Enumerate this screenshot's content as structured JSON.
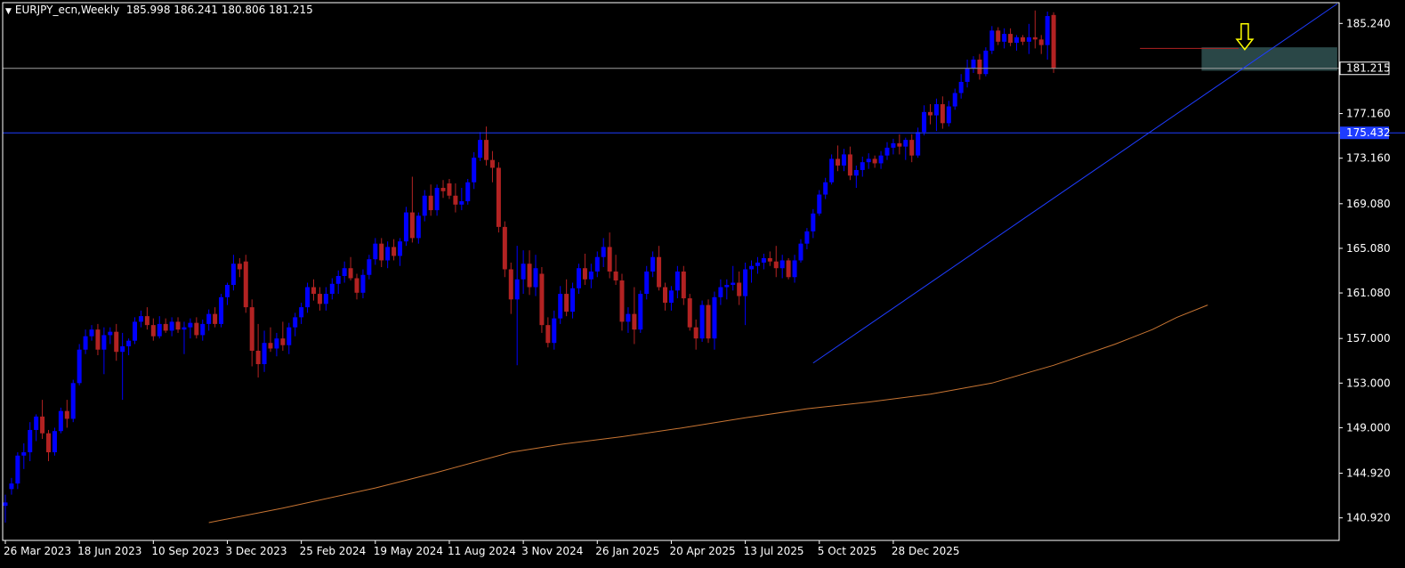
{
  "header": {
    "symbol": "EURJPY_ecn,Weekly",
    "ohlc": "185.998 186.241 180.806 181.215"
  },
  "colors": {
    "background": "#000000",
    "bull": "#0000ff",
    "bear": "#b22222",
    "axis": "#ffffff",
    "trendline": "#1e3cff",
    "ma": "#c87533",
    "level_line": "#1e3cff",
    "price_line": "#a0a0a0",
    "zone": "#2f4f4f",
    "arrow": "#ffff00"
  },
  "chart_data": {
    "type": "candlestick",
    "title": "EURJPY_ecn,Weekly",
    "timeframe": "Weekly",
    "ylim": [
      138.9,
      187.1
    ],
    "y_ticks": [
      "185.240",
      "181.215",
      "177.160",
      "175.432",
      "173.160",
      "169.080",
      "165.080",
      "161.080",
      "157.000",
      "153.000",
      "149.000",
      "144.920",
      "140.920"
    ],
    "x_ticks": [
      "26 Mar 2023",
      "18 Jun 2023",
      "10 Sep 2023",
      "3 Dec 2023",
      "25 Feb 2024",
      "19 May 2024",
      "11 Aug 2024",
      "3 Nov 2024",
      "26 Jan 2025",
      "20 Apr 2025",
      "13 Jul 2025",
      "5 Oct 2025",
      "28 Dec 2025"
    ],
    "current_price": 181.215,
    "horizontal_level": 175.432,
    "last_bar": {
      "open": 185.998,
      "high": 186.241,
      "low": 180.806,
      "close": 181.215
    },
    "candles": [
      {
        "o": 142.0,
        "h": 143.0,
        "l": 140.5,
        "c": 142.3
      },
      {
        "o": 143.5,
        "h": 144.5,
        "l": 143.0,
        "c": 144.0
      },
      {
        "o": 144.0,
        "h": 146.8,
        "l": 143.5,
        "c": 146.5
      },
      {
        "o": 146.5,
        "h": 147.6,
        "l": 145.3,
        "c": 146.8
      },
      {
        "o": 146.8,
        "h": 149.5,
        "l": 146.0,
        "c": 148.8
      },
      {
        "o": 148.8,
        "h": 150.2,
        "l": 147.8,
        "c": 150.0
      },
      {
        "o": 150.0,
        "h": 151.5,
        "l": 148.0,
        "c": 148.5
      },
      {
        "o": 148.5,
        "h": 148.8,
        "l": 146.0,
        "c": 146.8
      },
      {
        "o": 146.8,
        "h": 149.0,
        "l": 146.5,
        "c": 148.7
      },
      {
        "o": 148.7,
        "h": 150.8,
        "l": 148.5,
        "c": 150.5
      },
      {
        "o": 150.5,
        "h": 151.5,
        "l": 149.0,
        "c": 149.8
      },
      {
        "o": 149.8,
        "h": 153.3,
        "l": 149.5,
        "c": 153.0
      },
      {
        "o": 153.0,
        "h": 156.5,
        "l": 152.8,
        "c": 156.0
      },
      {
        "o": 156.0,
        "h": 157.8,
        "l": 155.6,
        "c": 157.2
      },
      {
        "o": 157.2,
        "h": 158.2,
        "l": 156.8,
        "c": 157.8
      },
      {
        "o": 157.8,
        "h": 158.3,
        "l": 155.5,
        "c": 156.0
      },
      {
        "o": 156.0,
        "h": 158.0,
        "l": 153.8,
        "c": 157.3
      },
      {
        "o": 157.3,
        "h": 158.0,
        "l": 156.5,
        "c": 157.6
      },
      {
        "o": 157.6,
        "h": 158.3,
        "l": 155.0,
        "c": 155.8
      },
      {
        "o": 155.8,
        "h": 157.5,
        "l": 151.5,
        "c": 156.3
      },
      {
        "o": 156.3,
        "h": 157.0,
        "l": 155.5,
        "c": 156.8
      },
      {
        "o": 156.8,
        "h": 158.9,
        "l": 156.5,
        "c": 158.5
      },
      {
        "o": 158.5,
        "h": 159.5,
        "l": 158.0,
        "c": 159.0
      },
      {
        "o": 159.0,
        "h": 159.8,
        "l": 157.8,
        "c": 158.2
      },
      {
        "o": 158.2,
        "h": 158.8,
        "l": 156.8,
        "c": 157.2
      },
      {
        "o": 157.2,
        "h": 159.0,
        "l": 157.0,
        "c": 158.3
      },
      {
        "o": 158.3,
        "h": 158.8,
        "l": 157.5,
        "c": 157.7
      },
      {
        "o": 157.7,
        "h": 158.9,
        "l": 157.2,
        "c": 158.5
      },
      {
        "o": 158.5,
        "h": 158.9,
        "l": 157.5,
        "c": 157.8
      },
      {
        "o": 157.8,
        "h": 158.5,
        "l": 155.6,
        "c": 158.0
      },
      {
        "o": 158.0,
        "h": 158.8,
        "l": 157.0,
        "c": 158.4
      },
      {
        "o": 158.4,
        "h": 158.9,
        "l": 157.0,
        "c": 157.3
      },
      {
        "o": 157.3,
        "h": 158.7,
        "l": 156.8,
        "c": 158.3
      },
      {
        "o": 158.3,
        "h": 159.6,
        "l": 157.7,
        "c": 159.2
      },
      {
        "o": 159.2,
        "h": 159.8,
        "l": 158.0,
        "c": 158.3
      },
      {
        "o": 158.3,
        "h": 161.0,
        "l": 158.0,
        "c": 160.7
      },
      {
        "o": 160.7,
        "h": 162.0,
        "l": 160.0,
        "c": 161.8
      },
      {
        "o": 161.8,
        "h": 164.5,
        "l": 161.3,
        "c": 163.7
      },
      {
        "o": 163.7,
        "h": 164.2,
        "l": 162.5,
        "c": 163.2
      },
      {
        "o": 163.9,
        "h": 164.5,
        "l": 159.3,
        "c": 159.8
      },
      {
        "o": 159.8,
        "h": 160.5,
        "l": 154.5,
        "c": 155.9
      },
      {
        "o": 155.9,
        "h": 158.3,
        "l": 153.5,
        "c": 154.7
      },
      {
        "o": 154.7,
        "h": 157.7,
        "l": 154.0,
        "c": 156.6
      },
      {
        "o": 156.6,
        "h": 158.0,
        "l": 155.8,
        "c": 156.1
      },
      {
        "o": 156.1,
        "h": 157.5,
        "l": 155.4,
        "c": 157.0
      },
      {
        "o": 157.0,
        "h": 158.5,
        "l": 155.9,
        "c": 156.4
      },
      {
        "o": 156.4,
        "h": 158.4,
        "l": 155.6,
        "c": 158.0
      },
      {
        "o": 158.0,
        "h": 159.3,
        "l": 157.2,
        "c": 158.9
      },
      {
        "o": 158.9,
        "h": 160.2,
        "l": 158.3,
        "c": 159.8
      },
      {
        "o": 159.8,
        "h": 162.0,
        "l": 159.3,
        "c": 161.6
      },
      {
        "o": 161.6,
        "h": 162.3,
        "l": 160.4,
        "c": 161.0
      },
      {
        "o": 161.0,
        "h": 161.6,
        "l": 159.5,
        "c": 160.1
      },
      {
        "o": 160.1,
        "h": 161.6,
        "l": 159.5,
        "c": 161.0
      },
      {
        "o": 161.0,
        "h": 162.4,
        "l": 160.5,
        "c": 161.9
      },
      {
        "o": 161.9,
        "h": 163.1,
        "l": 161.0,
        "c": 162.6
      },
      {
        "o": 162.6,
        "h": 163.9,
        "l": 162.0,
        "c": 163.3
      },
      {
        "o": 163.3,
        "h": 164.3,
        "l": 162.2,
        "c": 162.4
      },
      {
        "o": 162.4,
        "h": 162.8,
        "l": 160.5,
        "c": 161.1
      },
      {
        "o": 161.1,
        "h": 163.2,
        "l": 160.6,
        "c": 162.7
      },
      {
        "o": 162.7,
        "h": 164.5,
        "l": 162.3,
        "c": 164.1
      },
      {
        "o": 164.1,
        "h": 166.0,
        "l": 163.6,
        "c": 165.5
      },
      {
        "o": 165.5,
        "h": 166.0,
        "l": 163.4,
        "c": 164.0
      },
      {
        "o": 164.0,
        "h": 165.7,
        "l": 163.3,
        "c": 165.2
      },
      {
        "o": 165.2,
        "h": 165.9,
        "l": 164.0,
        "c": 164.4
      },
      {
        "o": 164.4,
        "h": 166.0,
        "l": 163.5,
        "c": 165.7
      },
      {
        "o": 165.7,
        "h": 168.8,
        "l": 165.3,
        "c": 168.3
      },
      {
        "o": 168.3,
        "h": 171.5,
        "l": 165.6,
        "c": 166.0
      },
      {
        "o": 166.0,
        "h": 168.3,
        "l": 165.5,
        "c": 168.0
      },
      {
        "o": 168.0,
        "h": 170.3,
        "l": 167.5,
        "c": 169.8
      },
      {
        "o": 169.8,
        "h": 170.8,
        "l": 168.0,
        "c": 168.5
      },
      {
        "o": 168.5,
        "h": 170.8,
        "l": 168.0,
        "c": 170.5
      },
      {
        "o": 170.5,
        "h": 171.2,
        "l": 169.6,
        "c": 170.2
      },
      {
        "o": 170.9,
        "h": 171.3,
        "l": 169.5,
        "c": 169.8
      },
      {
        "o": 169.8,
        "h": 170.9,
        "l": 168.3,
        "c": 169.0
      },
      {
        "o": 169.0,
        "h": 170.5,
        "l": 168.5,
        "c": 169.3
      },
      {
        "o": 169.3,
        "h": 171.3,
        "l": 169.0,
        "c": 171.0
      },
      {
        "o": 171.0,
        "h": 173.7,
        "l": 170.4,
        "c": 173.2
      },
      {
        "o": 173.2,
        "h": 175.5,
        "l": 172.9,
        "c": 174.8
      },
      {
        "o": 174.8,
        "h": 176.0,
        "l": 172.5,
        "c": 173.0
      },
      {
        "o": 173.0,
        "h": 173.8,
        "l": 171.0,
        "c": 172.3
      },
      {
        "o": 172.3,
        "h": 172.8,
        "l": 166.5,
        "c": 167.0
      },
      {
        "o": 167.0,
        "h": 167.5,
        "l": 162.5,
        "c": 163.2
      },
      {
        "o": 163.2,
        "h": 163.8,
        "l": 159.2,
        "c": 160.5
      },
      {
        "o": 160.5,
        "h": 165.3,
        "l": 154.6,
        "c": 162.3
      },
      {
        "o": 162.3,
        "h": 164.9,
        "l": 161.0,
        "c": 163.7
      },
      {
        "o": 163.7,
        "h": 164.9,
        "l": 160.9,
        "c": 161.6
      },
      {
        "o": 161.6,
        "h": 164.5,
        "l": 160.8,
        "c": 163.3
      },
      {
        "o": 162.8,
        "h": 163.4,
        "l": 157.5,
        "c": 158.2
      },
      {
        "o": 158.2,
        "h": 158.9,
        "l": 156.2,
        "c": 156.6
      },
      {
        "o": 156.6,
        "h": 159.5,
        "l": 156.0,
        "c": 158.8
      },
      {
        "o": 158.8,
        "h": 161.7,
        "l": 158.3,
        "c": 161.0
      },
      {
        "o": 161.0,
        "h": 162.3,
        "l": 159.0,
        "c": 159.4
      },
      {
        "o": 159.4,
        "h": 162.0,
        "l": 158.8,
        "c": 161.5
      },
      {
        "o": 161.5,
        "h": 163.7,
        "l": 161.0,
        "c": 163.3
      },
      {
        "o": 163.3,
        "h": 164.6,
        "l": 161.8,
        "c": 162.3
      },
      {
        "o": 162.3,
        "h": 163.7,
        "l": 161.5,
        "c": 163.0
      },
      {
        "o": 163.0,
        "h": 164.8,
        "l": 162.5,
        "c": 164.3
      },
      {
        "o": 164.3,
        "h": 166.0,
        "l": 163.4,
        "c": 165.2
      },
      {
        "o": 165.2,
        "h": 166.5,
        "l": 162.4,
        "c": 163.0
      },
      {
        "o": 163.0,
        "h": 164.5,
        "l": 161.8,
        "c": 162.2
      },
      {
        "o": 162.2,
        "h": 162.8,
        "l": 157.7,
        "c": 158.5
      },
      {
        "o": 158.5,
        "h": 159.8,
        "l": 157.5,
        "c": 159.2
      },
      {
        "o": 159.2,
        "h": 161.6,
        "l": 156.5,
        "c": 157.8
      },
      {
        "o": 157.8,
        "h": 161.3,
        "l": 157.5,
        "c": 161.0
      },
      {
        "o": 161.0,
        "h": 163.5,
        "l": 160.5,
        "c": 163.0
      },
      {
        "o": 163.0,
        "h": 164.8,
        "l": 162.5,
        "c": 164.3
      },
      {
        "o": 164.3,
        "h": 165.3,
        "l": 161.3,
        "c": 161.6
      },
      {
        "o": 161.6,
        "h": 162.0,
        "l": 159.5,
        "c": 160.2
      },
      {
        "o": 160.2,
        "h": 161.7,
        "l": 159.5,
        "c": 161.3
      },
      {
        "o": 161.3,
        "h": 163.5,
        "l": 160.6,
        "c": 163.0
      },
      {
        "o": 163.0,
        "h": 163.5,
        "l": 160.0,
        "c": 160.6
      },
      {
        "o": 160.6,
        "h": 161.0,
        "l": 157.7,
        "c": 158.0
      },
      {
        "o": 158.0,
        "h": 158.7,
        "l": 156.0,
        "c": 157.0
      },
      {
        "o": 157.0,
        "h": 160.4,
        "l": 156.7,
        "c": 160.0
      },
      {
        "o": 160.0,
        "h": 160.5,
        "l": 156.6,
        "c": 157.0
      },
      {
        "o": 157.0,
        "h": 161.2,
        "l": 156.0,
        "c": 160.7
      },
      {
        "o": 160.7,
        "h": 162.3,
        "l": 160.0,
        "c": 161.6
      },
      {
        "o": 161.6,
        "h": 162.3,
        "l": 160.5,
        "c": 161.8
      },
      {
        "o": 161.8,
        "h": 163.5,
        "l": 161.3,
        "c": 162.0
      },
      {
        "o": 162.0,
        "h": 163.0,
        "l": 160.0,
        "c": 160.8
      },
      {
        "o": 160.8,
        "h": 163.8,
        "l": 158.2,
        "c": 163.2
      },
      {
        "o": 163.2,
        "h": 164.0,
        "l": 162.0,
        "c": 163.5
      },
      {
        "o": 163.5,
        "h": 164.3,
        "l": 162.8,
        "c": 163.8
      },
      {
        "o": 163.8,
        "h": 164.6,
        "l": 163.2,
        "c": 164.2
      },
      {
        "o": 164.2,
        "h": 164.8,
        "l": 163.5,
        "c": 163.9
      },
      {
        "o": 163.9,
        "h": 165.3,
        "l": 162.5,
        "c": 163.3
      },
      {
        "o": 163.3,
        "h": 164.5,
        "l": 162.4,
        "c": 164.0
      },
      {
        "o": 164.0,
        "h": 164.2,
        "l": 162.3,
        "c": 162.5
      },
      {
        "o": 162.5,
        "h": 164.5,
        "l": 162.0,
        "c": 164.0
      },
      {
        "o": 164.0,
        "h": 165.9,
        "l": 163.8,
        "c": 165.5
      },
      {
        "o": 165.5,
        "h": 166.9,
        "l": 165.0,
        "c": 166.6
      },
      {
        "o": 166.6,
        "h": 168.6,
        "l": 166.0,
        "c": 168.2
      },
      {
        "o": 168.2,
        "h": 170.3,
        "l": 168.0,
        "c": 169.9
      },
      {
        "o": 169.9,
        "h": 171.4,
        "l": 169.5,
        "c": 171.0
      },
      {
        "o": 171.0,
        "h": 173.5,
        "l": 170.8,
        "c": 173.1
      },
      {
        "o": 173.1,
        "h": 174.3,
        "l": 172.0,
        "c": 172.5
      },
      {
        "o": 172.5,
        "h": 174.0,
        "l": 172.0,
        "c": 173.5
      },
      {
        "o": 173.5,
        "h": 174.2,
        "l": 171.2,
        "c": 171.6
      },
      {
        "o": 171.6,
        "h": 172.5,
        "l": 170.5,
        "c": 172.1
      },
      {
        "o": 172.1,
        "h": 173.3,
        "l": 171.5,
        "c": 172.8
      },
      {
        "o": 172.8,
        "h": 173.6,
        "l": 172.2,
        "c": 173.1
      },
      {
        "o": 173.1,
        "h": 173.4,
        "l": 172.3,
        "c": 172.7
      },
      {
        "o": 172.7,
        "h": 173.8,
        "l": 172.2,
        "c": 173.4
      },
      {
        "o": 173.4,
        "h": 174.6,
        "l": 173.0,
        "c": 174.1
      },
      {
        "o": 174.1,
        "h": 174.9,
        "l": 173.5,
        "c": 174.5
      },
      {
        "o": 174.5,
        "h": 175.3,
        "l": 173.5,
        "c": 174.2
      },
      {
        "o": 174.2,
        "h": 175.0,
        "l": 173.0,
        "c": 174.8
      },
      {
        "o": 174.8,
        "h": 175.3,
        "l": 172.8,
        "c": 173.4
      },
      {
        "o": 173.4,
        "h": 175.9,
        "l": 173.2,
        "c": 175.5
      },
      {
        "o": 175.5,
        "h": 177.9,
        "l": 175.2,
        "c": 177.3
      },
      {
        "o": 177.3,
        "h": 178.0,
        "l": 176.2,
        "c": 177.0
      },
      {
        "o": 177.0,
        "h": 178.5,
        "l": 175.6,
        "c": 178.0
      },
      {
        "o": 178.0,
        "h": 178.7,
        "l": 175.8,
        "c": 176.3
      },
      {
        "o": 176.3,
        "h": 178.3,
        "l": 176.0,
        "c": 177.8
      },
      {
        "o": 177.8,
        "h": 179.4,
        "l": 177.5,
        "c": 179.0
      },
      {
        "o": 179.0,
        "h": 180.7,
        "l": 178.5,
        "c": 180.0
      },
      {
        "o": 180.0,
        "h": 182.0,
        "l": 179.5,
        "c": 181.2
      },
      {
        "o": 181.2,
        "h": 182.3,
        "l": 180.8,
        "c": 182.0
      },
      {
        "o": 182.0,
        "h": 182.5,
        "l": 180.2,
        "c": 180.7
      },
      {
        "o": 180.7,
        "h": 183.1,
        "l": 180.5,
        "c": 182.8
      },
      {
        "o": 182.8,
        "h": 185.0,
        "l": 182.5,
        "c": 184.6
      },
      {
        "o": 184.6,
        "h": 184.9,
        "l": 183.3,
        "c": 183.6
      },
      {
        "o": 183.6,
        "h": 184.8,
        "l": 183.0,
        "c": 184.3
      },
      {
        "o": 184.3,
        "h": 184.8,
        "l": 183.2,
        "c": 183.5
      },
      {
        "o": 183.5,
        "h": 184.2,
        "l": 182.8,
        "c": 184.0
      },
      {
        "o": 184.0,
        "h": 184.2,
        "l": 183.3,
        "c": 183.6
      },
      {
        "o": 183.6,
        "h": 185.2,
        "l": 182.5,
        "c": 184.0
      },
      {
        "o": 184.0,
        "h": 186.4,
        "l": 183.0,
        "c": 183.8
      },
      {
        "o": 183.8,
        "h": 184.2,
        "l": 182.5,
        "c": 183.3
      },
      {
        "o": 183.3,
        "h": 186.3,
        "l": 182.0,
        "c": 185.9
      },
      {
        "o": 185.998,
        "h": 186.241,
        "l": 180.806,
        "c": 181.215
      }
    ],
    "ma_line": [
      {
        "i": 33,
        "v": 140.5
      },
      {
        "i": 45,
        "v": 141.8
      },
      {
        "i": 60,
        "v": 143.6
      },
      {
        "i": 70,
        "v": 145.0
      },
      {
        "i": 82,
        "v": 146.8
      },
      {
        "i": 90,
        "v": 147.5
      },
      {
        "i": 100,
        "v": 148.2
      },
      {
        "i": 110,
        "v": 149.0
      },
      {
        "i": 120,
        "v": 149.9
      },
      {
        "i": 130,
        "v": 150.7
      },
      {
        "i": 140,
        "v": 151.3
      },
      {
        "i": 150,
        "v": 152.0
      },
      {
        "i": 160,
        "v": 153.0
      },
      {
        "i": 170,
        "v": 154.6
      },
      {
        "i": 180,
        "v": 156.5
      },
      {
        "i": 186,
        "v": 157.8
      },
      {
        "i": 190,
        "v": 158.9
      },
      {
        "i": 195,
        "v": 160.0
      }
    ],
    "trendline": {
      "i1": 131,
      "v1": 154.8,
      "i2": 216,
      "v2": 187.0
    },
    "current_bar_line": {
      "i1": 184,
      "i2": 200,
      "v": 183.0
    },
    "zone": {
      "i1": 194,
      "i2": 216,
      "y_top": 183.1,
      "y_bottom": 181.0
    },
    "arrow": {
      "i": 201,
      "v_top": 185.2,
      "v_bottom": 182.9
    }
  }
}
